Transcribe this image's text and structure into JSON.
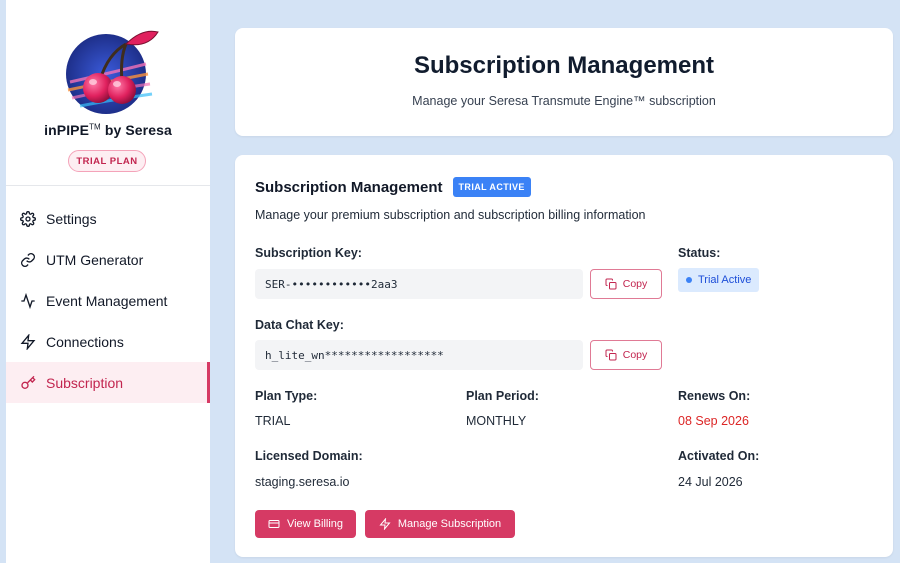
{
  "brand": {
    "name": "inPIPE",
    "trademark": "TM",
    "suffix": " by Seresa",
    "plan_pill": "TRIAL PLAN"
  },
  "sidebar": {
    "items": [
      {
        "label": "Settings",
        "icon": "gear-icon"
      },
      {
        "label": "UTM Generator",
        "icon": "link-icon"
      },
      {
        "label": "Event Management",
        "icon": "activity-icon"
      },
      {
        "label": "Connections",
        "icon": "bolt-icon"
      },
      {
        "label": "Subscription",
        "icon": "key-icon",
        "active": true
      }
    ]
  },
  "header": {
    "title": "Subscription Management",
    "subtitle": "Manage your Seresa Transmute Engine™ subscription"
  },
  "main": {
    "title": "Subscription Management",
    "status_tag": "TRIAL ACTIVE",
    "description": "Manage your premium subscription and subscription billing information",
    "subscription_key": {
      "label": "Subscription Key:",
      "value": "SER-••••••••••••2aa3",
      "copy_label": "Copy"
    },
    "data_chat_key": {
      "label": "Data Chat Key:",
      "value": "h_lite_wn******************",
      "copy_label": "Copy"
    },
    "status": {
      "label": "Status:",
      "value": "Trial Active"
    },
    "plan_type": {
      "label": "Plan Type:",
      "value": "TRIAL"
    },
    "plan_period": {
      "label": "Plan Period:",
      "value": "MONTHLY"
    },
    "renews_on": {
      "label": "Renews On:",
      "value": "08 Sep 2026"
    },
    "licensed_domain": {
      "label": "Licensed Domain:",
      "value": "staging.seresa.io"
    },
    "activated_on": {
      "label": "Activated On:",
      "value": "24 Jul 2026"
    },
    "buttons": {
      "view_billing": "View Billing",
      "manage_subscription": "Manage Subscription"
    }
  },
  "colors": {
    "accent": "#d63a64",
    "info": "#3b82f6",
    "danger": "#dc2626",
    "background": "#d4e3f5"
  }
}
